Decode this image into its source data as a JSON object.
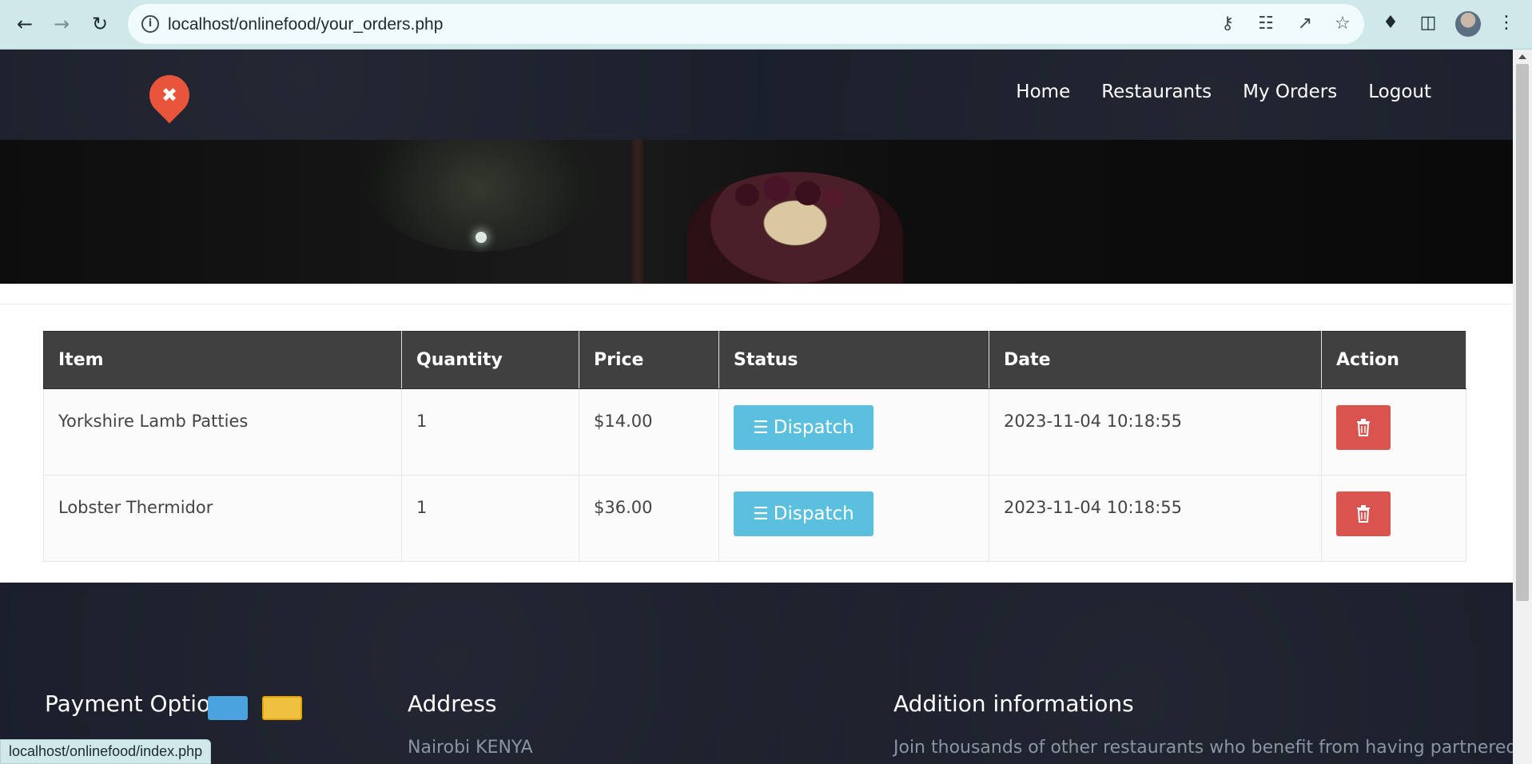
{
  "browser": {
    "url": "localhost/onlinefood/your_orders.php",
    "status_url": "localhost/onlinefood/index.php"
  },
  "nav": {
    "items": [
      "Home",
      "Restaurants",
      "My Orders",
      "Logout"
    ]
  },
  "table": {
    "headers": [
      "Item",
      "Quantity",
      "Price",
      "Status",
      "Date",
      "Action"
    ],
    "rows": [
      {
        "item": "Yorkshire Lamb Patties",
        "quantity": "1",
        "price": "$14.00",
        "status": "Dispatch",
        "date": "2023-11-04 10:18:55"
      },
      {
        "item": "Lobster Thermidor",
        "quantity": "1",
        "price": "$36.00",
        "status": "Dispatch",
        "date": "2023-11-04 10:18:55"
      }
    ]
  },
  "footer": {
    "payment_title": "Payment Options",
    "address_title": "Address",
    "address_text": "Nairobi KENYA",
    "info_title": "Addition informations",
    "info_text": "Join thousands of other restaurants who benefit from having partnered"
  },
  "colors": {
    "status_button": "#5bc0de",
    "delete_button": "#d9534f",
    "table_header": "#404040",
    "header_bg": "#1a1f2b",
    "logo": "#e8553a"
  }
}
